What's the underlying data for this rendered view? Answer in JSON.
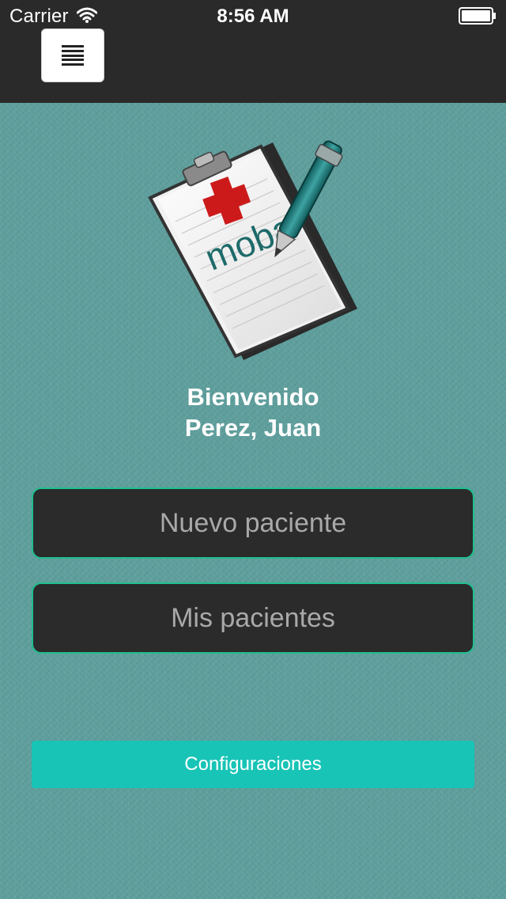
{
  "status_bar": {
    "carrier": "Carrier",
    "time": "8:56 AM",
    "wifi_icon": "wifi-icon",
    "battery_icon": "battery-icon"
  },
  "toolbar": {
    "menu_icon": "hamburger-menu-icon"
  },
  "logo": {
    "text": "moba",
    "icon": "clipboard-with-pen-and-red-cross"
  },
  "welcome": {
    "greeting": "Bienvenido",
    "user_name": "Perez, Juan"
  },
  "buttons": {
    "new_patient": "Nuevo paciente",
    "my_patients": "Mis pacientes",
    "settings": "Configuraciones"
  },
  "colors": {
    "background": "#5e9e9c",
    "top_bar": "#2a2a2a",
    "button_dark": "#2b2b2b",
    "button_border": "#1fbf8f",
    "settings_button": "#18c4b6",
    "logo_red": "#cc1a1a",
    "logo_teal": "#1e6a6a"
  }
}
